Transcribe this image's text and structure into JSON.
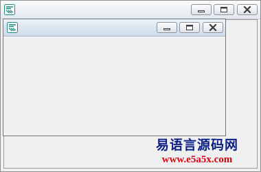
{
  "outer_window": {
    "title": "",
    "controls": {
      "minimize": "minimize-icon",
      "maximize": "maximize-icon",
      "close": "close-icon"
    }
  },
  "inner_window": {
    "title": "",
    "controls": {
      "minimize": "minimize-icon",
      "maximize": "maximize-icon",
      "close": "close-icon"
    }
  },
  "watermark": {
    "chinese": "易语言源码网",
    "url": "www.e5a5x.com"
  },
  "colors": {
    "watermark_chinese": "#0a1f86",
    "watermark_url": "#d8000f",
    "app_icon": "#1d8a80"
  }
}
